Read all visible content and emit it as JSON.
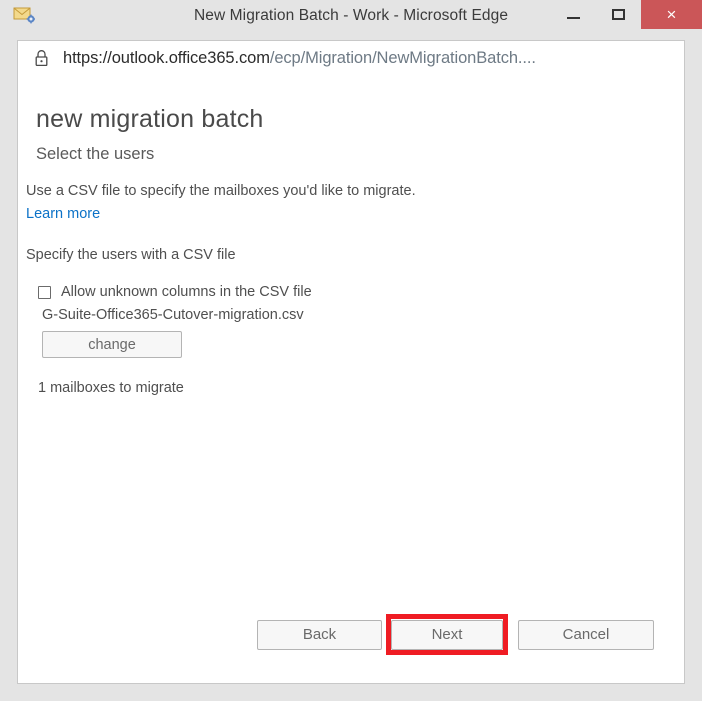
{
  "window": {
    "title": "New Migration Batch - Work - Microsoft Edge",
    "app_icon": "mail-settings-icon",
    "controls": {
      "minimize": "–",
      "maximize": "□",
      "close": "×"
    },
    "close_button_color": "#cb5658"
  },
  "address_bar": {
    "lock_icon": "lock-icon",
    "url_host": "https://outlook.office365.com",
    "url_path": "/ecp/Migration/NewMigrationBatch....",
    "url_full": "https://outlook.office365.com/ecp/Migration/NewMigrationBatch...."
  },
  "page": {
    "heading": "new migration batch",
    "subheading": "Select the users",
    "intro_text": "Use a CSV file to specify the mailboxes you'd like to migrate.",
    "learn_more_link": "Learn more",
    "learn_more_color": "#0c72c7",
    "specify_label": "Specify the users with a CSV file",
    "allow_unknown_columns": {
      "label": "Allow unknown columns in the CSV file",
      "checked": false
    },
    "csv_filename": "G-Suite-Office365-Cutover-migration.csv",
    "change_button": "change",
    "mailbox_count_text": "1 mailboxes to migrate"
  },
  "footer": {
    "back_button": "Back",
    "next_button": "Next",
    "cancel_button": "Cancel",
    "highlight_color": "#ef1c23",
    "highlighted_button": "Next"
  }
}
